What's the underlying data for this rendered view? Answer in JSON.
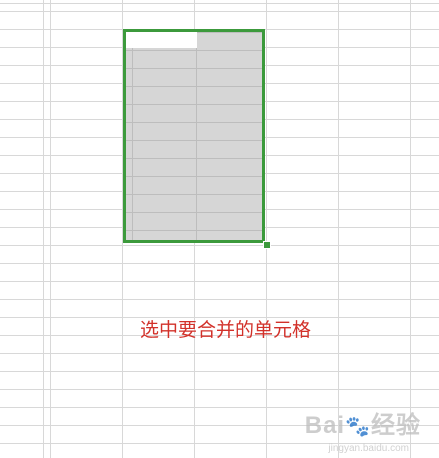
{
  "caption": "选中要合并的单元格",
  "watermark": {
    "text_left": "Bai",
    "paw_glyph": "🐾",
    "text_right": "经验",
    "url": "jingyan.baidu.com"
  },
  "colors": {
    "selection_border": "#3c9a3c",
    "selection_fill": "#d6d6d6",
    "caption": "#d2312a",
    "gridline": "#d8d8d8"
  }
}
